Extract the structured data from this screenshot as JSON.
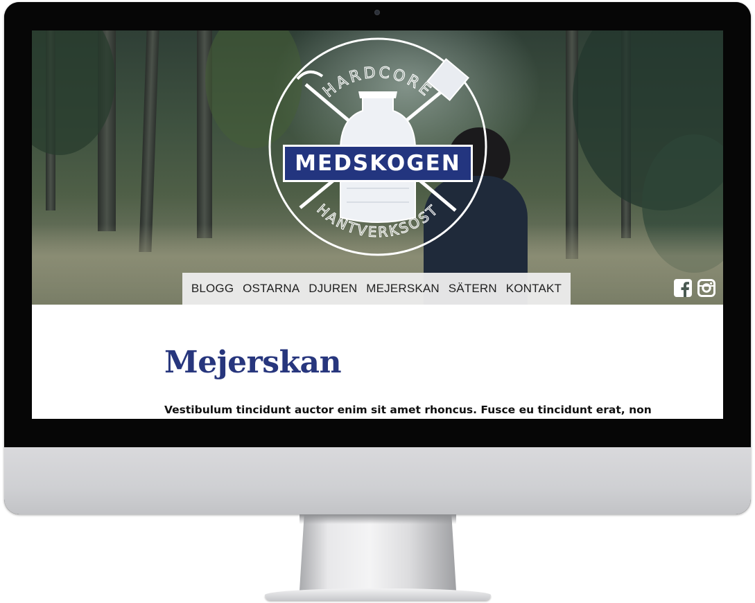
{
  "logo": {
    "top_text": "HARDCORE",
    "name": "MEDSKOGEN",
    "bottom_text": "HANTVERKSOST"
  },
  "nav": {
    "items": [
      "BLOGG",
      "OSTARNA",
      "DJUREN",
      "MEJERSKAN",
      "SÄTERN",
      "KONTAKT"
    ]
  },
  "social": {
    "icons": [
      "facebook-icon",
      "instagram-icon"
    ]
  },
  "page": {
    "title": "Mejerskan",
    "intro": "Vestibulum tincidunt auctor enim sit amet rhoncus. Fusce eu tincidunt erat, non"
  },
  "colors": {
    "brand_blue": "#23357f",
    "title_blue": "#27367d",
    "nav_background": "#ececec"
  }
}
